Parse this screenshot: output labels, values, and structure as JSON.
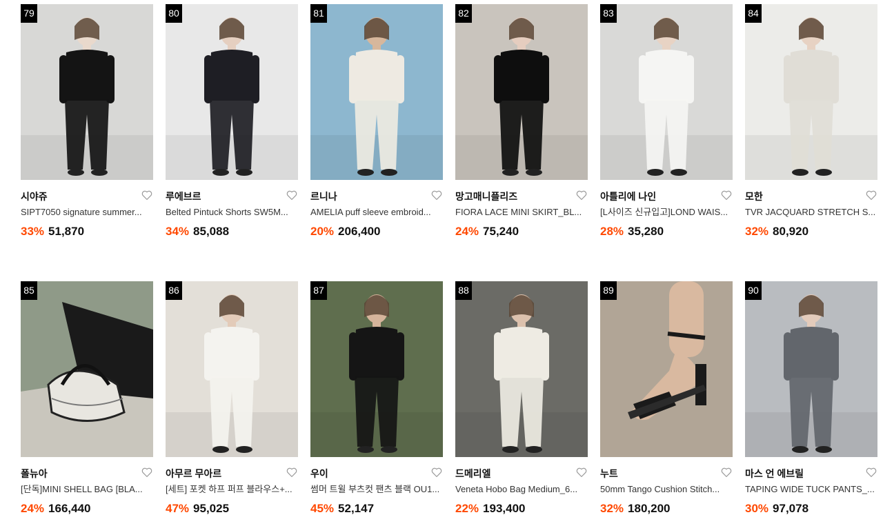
{
  "colors": {
    "discount": "#ff4800",
    "rank_bg": "#000000"
  },
  "rows": [
    [
      {
        "rank": "79",
        "brand": "시야쥬",
        "name": "SIPT7050 signature summer...",
        "discount": "33%",
        "price": "51,870",
        "bg": "#d8d8d6",
        "fg": "#141414",
        "skin": "#e9d9cc",
        "image": "model-black-trousers"
      },
      {
        "rank": "80",
        "brand": "루에브르",
        "name": "Belted Pintuck Shorts SW5M...",
        "discount": "34%",
        "price": "85,088",
        "bg": "#e8e8e8",
        "fg": "#1e1e24",
        "skin": "#e5cfc0",
        "image": "model-black-shorts"
      },
      {
        "rank": "81",
        "brand": "르니나",
        "name": "AMELIA puff sleeve embroid...",
        "discount": "20%",
        "price": "206,400",
        "bg": "#8db7cf",
        "fg": "#eeeae2",
        "skin": "#d7b79c",
        "image": "model-white-dress-beach"
      },
      {
        "rank": "82",
        "brand": "망고매니플리즈",
        "name": "FIORA LACE MINI SKIRT_BL...",
        "discount": "24%",
        "price": "75,240",
        "bg": "#c9c4bd",
        "fg": "#0e0e0e",
        "skin": "#e5cdbf",
        "image": "model-black-lace-skirt"
      },
      {
        "rank": "83",
        "brand": "아틀리에 나인",
        "name": "[L사이즈 신규입고]LOND WAIS...",
        "discount": "28%",
        "price": "35,280",
        "bg": "#d9d9d7",
        "fg": "#f5f5f3",
        "skin": "#e8d3c4",
        "image": "model-white-top"
      },
      {
        "rank": "84",
        "brand": "모한",
        "name": "TVR JACQUARD STRETCH S...",
        "discount": "32%",
        "price": "80,920",
        "bg": "#ecece9",
        "fg": "#e0ddd6",
        "skin": "#e7d2c3",
        "image": "model-jacquard-set"
      }
    ],
    [
      {
        "rank": "85",
        "brand": "폴뉴아",
        "name": "[단독]MINI SHELL BAG [BLA...",
        "discount": "24%",
        "price": "166,440",
        "bg": "#8f9a88",
        "fg": "#2a2a2a",
        "skin": "#c8a587",
        "image": "shell-bag"
      },
      {
        "rank": "86",
        "brand": "아무르 무아르",
        "name": "[세트] 포켓 하프 퍼프 블라우스+...",
        "discount": "47%",
        "price": "95,025",
        "bg": "#e3dfd8",
        "fg": "#f4f3ef",
        "skin": "#e3cbb9",
        "image": "model-white-set"
      },
      {
        "rank": "87",
        "brand": "우이",
        "name": "썸머 트윌 부츠컷 팬츠 블랙 OU1...",
        "discount": "45%",
        "price": "52,147",
        "bg": "#5f6e4e",
        "fg": "#151515",
        "skin": "#d5b49b",
        "image": "model-bootcut-pants"
      },
      {
        "rank": "88",
        "brand": "드메리엘",
        "name": "Veneta Hobo Bag Medium_6...",
        "discount": "22%",
        "price": "193,400",
        "bg": "#6b6b66",
        "fg": "#eeebe3",
        "skin": "#dcc1ad",
        "image": "model-hobo-bag"
      },
      {
        "rank": "89",
        "brand": "누트",
        "name": "50mm Tango Cushion Stitch...",
        "discount": "32%",
        "price": "180,200",
        "bg": "#b1a596",
        "fg": "#1a1a1a",
        "skin": "#d9b9a0",
        "image": "black-sandal"
      },
      {
        "rank": "90",
        "brand": "마스 언 에브릴",
        "name": "TAPING WIDE TUCK PANTS_...",
        "discount": "30%",
        "price": "97,078",
        "bg": "#b9bcc0",
        "fg": "#62666c",
        "skin": "#e3cbbb",
        "image": "model-wide-pants"
      }
    ]
  ]
}
